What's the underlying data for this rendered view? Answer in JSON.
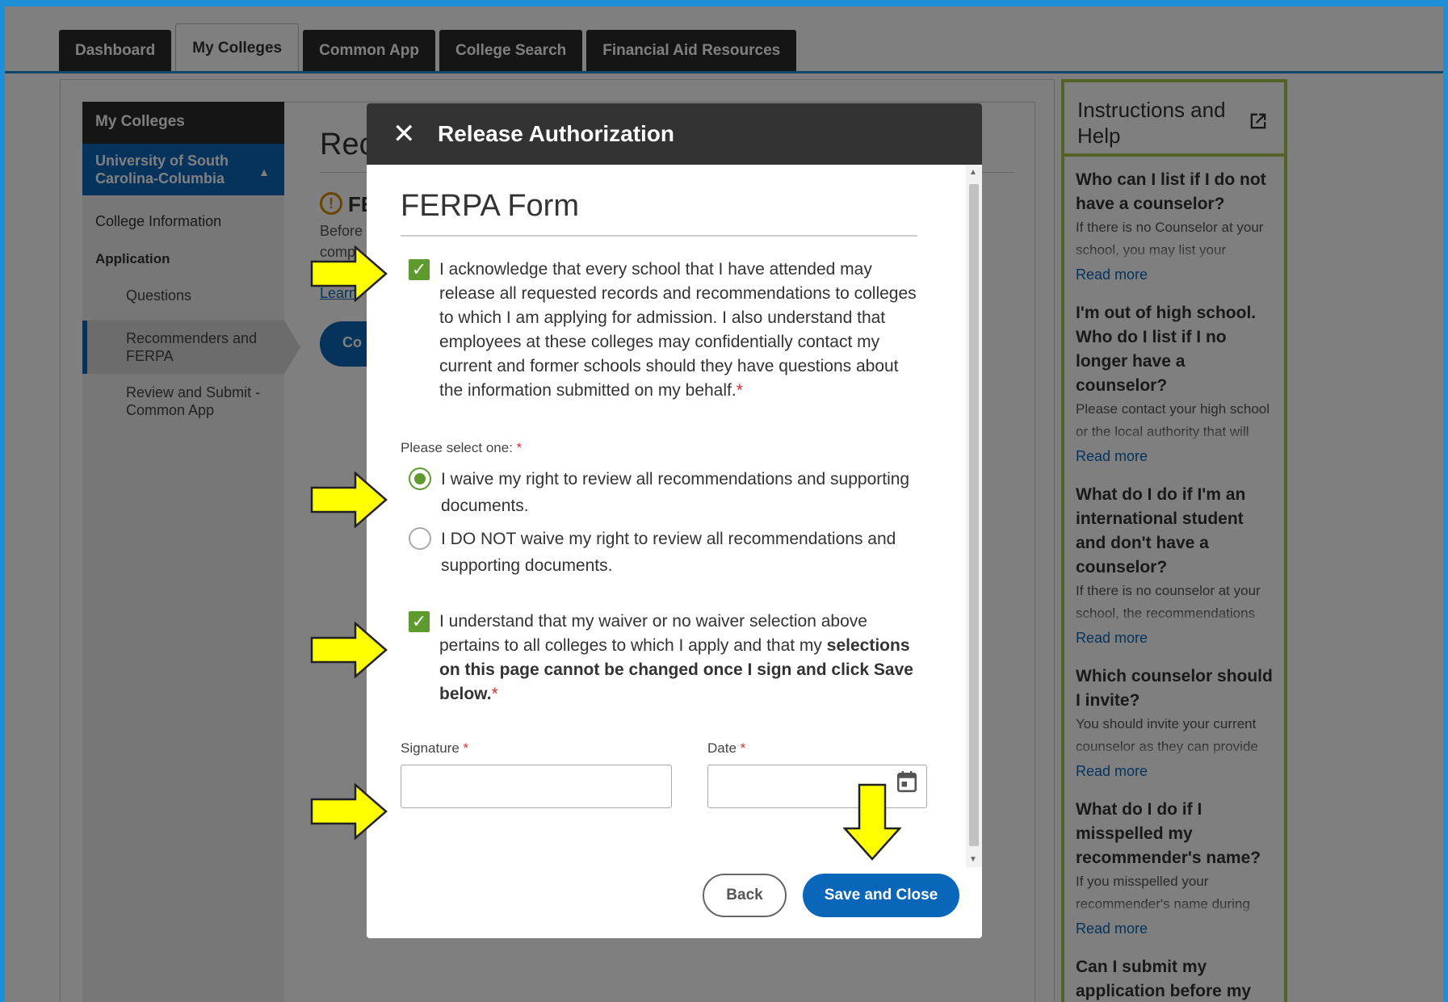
{
  "tabs": [
    {
      "label": "Dashboard",
      "active": false
    },
    {
      "label": "My Colleges",
      "active": true
    },
    {
      "label": "Common App",
      "active": false
    },
    {
      "label": "College Search",
      "active": false
    },
    {
      "label": "Financial Aid Resources",
      "active": false
    }
  ],
  "sidebar": {
    "heading": "My Colleges",
    "college": "University of South Carolina-Columbia",
    "items": {
      "college_info": "College Information",
      "application": "Application",
      "questions": "Questions",
      "recommenders": "Recommenders and FERPA",
      "review": "Review and Submit - Common App"
    }
  },
  "background": {
    "heading": "Rec",
    "warning_title": "FE",
    "text1": "Before",
    "text2": "comp",
    "link": "Learn",
    "button": "Co"
  },
  "help": {
    "title": "Instructions and Help",
    "read_more": "Read more",
    "items": [
      {
        "q": "Who can I list if I do not have a counselor?",
        "a": "If there is no Counselor at your school, you may list your principal or other"
      },
      {
        "q": "I'm out of high school. Who do I list if I no longer have a counselor?",
        "a": "Please contact your high school or the local authority that will provide your"
      },
      {
        "q": "What do I do if I'm an international student and don't have a counselor?",
        "a": "If there is no counselor at your school, the recommendations may be"
      },
      {
        "q": "Which counselor should I invite?",
        "a": "You should invite your current counselor as they can provide your current"
      },
      {
        "q": "What do I do if I misspelled my recommender's name?",
        "a": "If you misspelled your recommender's name during the invitation process, you"
      },
      {
        "q": "Can I submit my application before my",
        "a": ""
      }
    ]
  },
  "modal": {
    "title": "Release Authorization",
    "form_title": "FERPA Form",
    "ack_text": "I acknowledge that every school that I have attended may release all requested records and recommendations to colleges to which I am applying for admission. I also understand that employees at these colleges may confidentially contact my current and former schools should they have questions about the information submitted on my behalf.",
    "required_mark": "*",
    "select_label": "Please select one:",
    "radio_waive": "I waive my right to review all recommendations and supporting documents.",
    "radio_not_waive": "I DO NOT waive my right to review all recommendations and supporting documents.",
    "understand_text": "I understand that my waiver or no waiver selection above pertains to all colleges to which I apply and that my",
    "understand_bold": "selections on this page cannot be changed once I sign and click Save below.",
    "signature_label": "Signature",
    "signature_value": "",
    "date_label": "Date",
    "date_value": "",
    "back_label": "Back",
    "save_label": "Save and Close"
  },
  "colors": {
    "accent": "#0a66b8",
    "check": "#5e9a2e",
    "help_border": "#a8c64a",
    "arrow": "#ffff00"
  }
}
